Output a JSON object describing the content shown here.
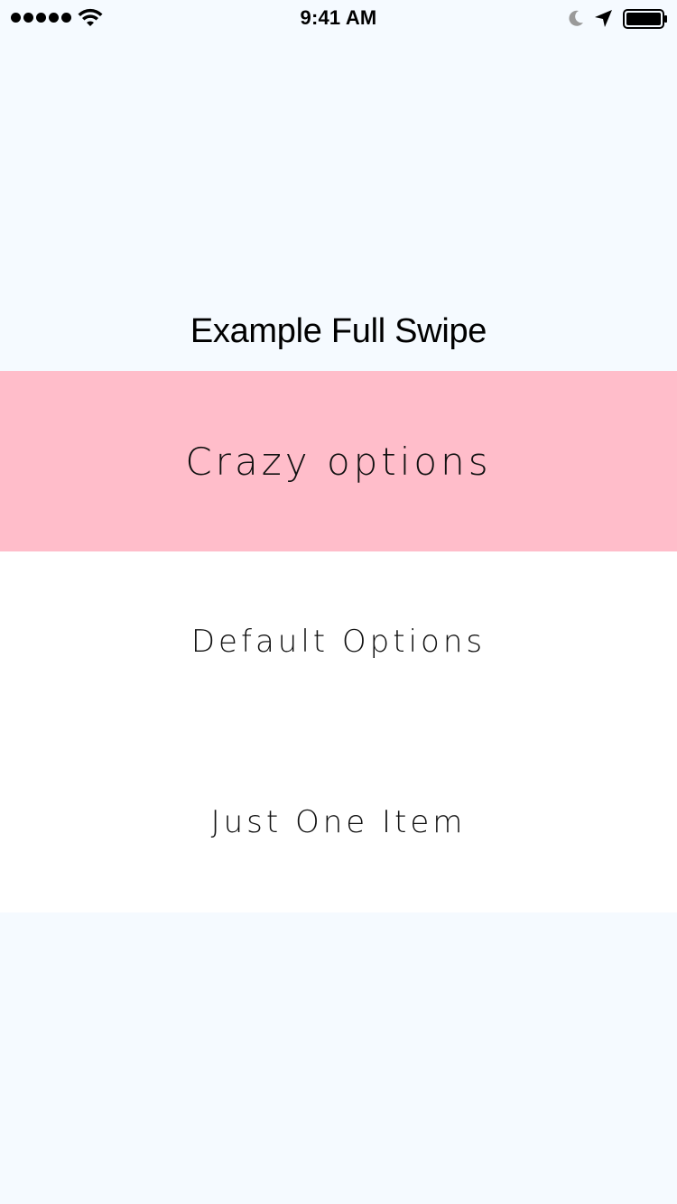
{
  "status_bar": {
    "time": "9:41 AM",
    "signal_icon": "signal-dots-icon",
    "wifi_icon": "wifi-icon",
    "moon_icon": "do-not-disturb-moon-icon",
    "location_icon": "location-arrow-icon",
    "battery_icon": "battery-icon",
    "battery_level": 1.0
  },
  "header": {
    "title": "Example Full Swipe"
  },
  "list": {
    "rows": [
      {
        "label": "Crazy options",
        "highlighted": true
      },
      {
        "label": "Default Options",
        "highlighted": false
      },
      {
        "label": "Just One Item",
        "highlighted": false
      }
    ]
  },
  "colors": {
    "background": "#f5faff",
    "row_background": "#ffffff",
    "highlight_row": "#ffbdca",
    "text": "#000000"
  }
}
